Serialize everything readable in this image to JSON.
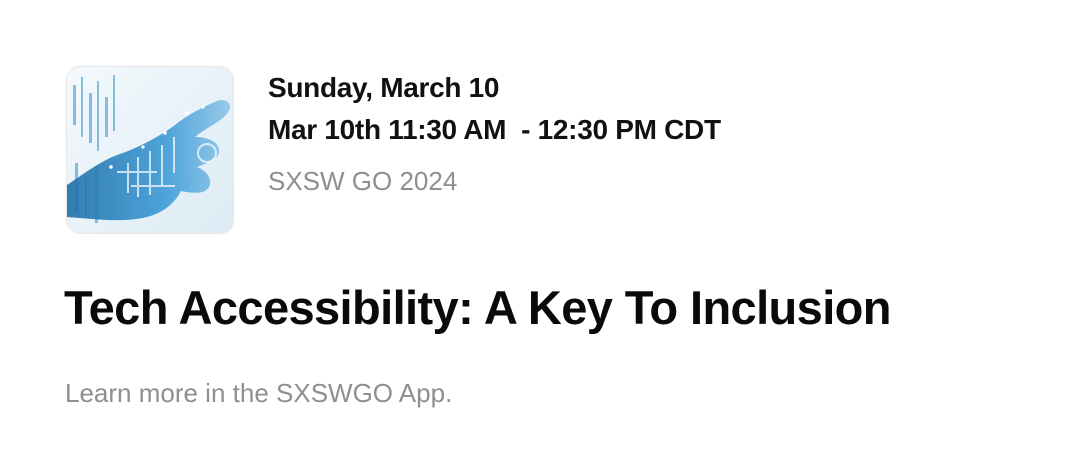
{
  "session": {
    "image_icon": "digital-hand-image",
    "day_date": "Sunday, March 10",
    "time_range": "Mar 10th 11:30 AM  - 12:30 PM CDT",
    "event": "SXSW GO 2024",
    "title": "Tech Accessibility: A Key To Inclusion",
    "cta_text": "Learn more in the SXSWGO App."
  },
  "colors": {
    "primary_text": "#111111",
    "secondary_text": "#8e8e93",
    "image_accent": "#2a8fcf"
  }
}
